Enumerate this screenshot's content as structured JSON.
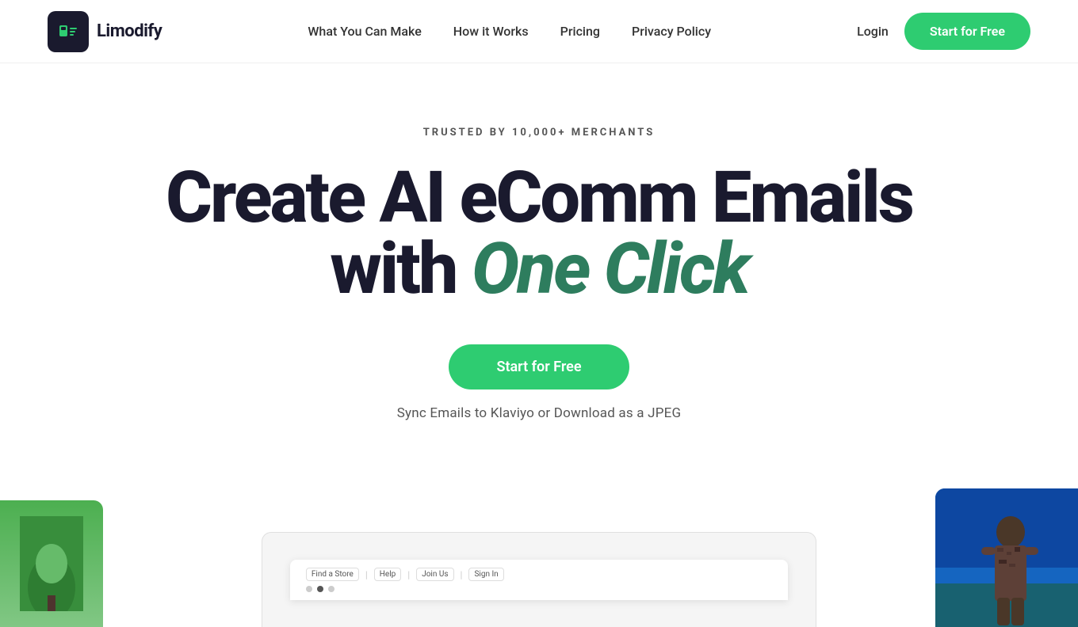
{
  "brand": {
    "name": "Limodify",
    "logo_alt": "Limodify logo"
  },
  "nav": {
    "links": [
      {
        "label": "What You Can Make",
        "href": "#"
      },
      {
        "label": "How it Works",
        "href": "#"
      },
      {
        "label": "Pricing",
        "href": "#"
      },
      {
        "label": "Privacy Policy",
        "href": "#"
      },
      {
        "label": "Login",
        "href": "#"
      }
    ],
    "cta_label": "Start for Free"
  },
  "hero": {
    "trusted_badge": "TRUSTED BY 10,000+ MERCHANTS",
    "title_line1": "Create AI eComm Emails",
    "title_line2_prefix": "with ",
    "title_line2_italic": "One Click",
    "cta_button": "Start for Free",
    "subtext": "Sync Emails to Klaviyo or Download as a JPEG"
  },
  "colors": {
    "accent": "#2ecc71",
    "dark": "#1a1a2e",
    "italic_green": "#2e7d5e"
  },
  "preview": {
    "mockup_nav_items": [
      "Find a Store",
      "Help",
      "Join Us",
      "Sign In"
    ]
  }
}
